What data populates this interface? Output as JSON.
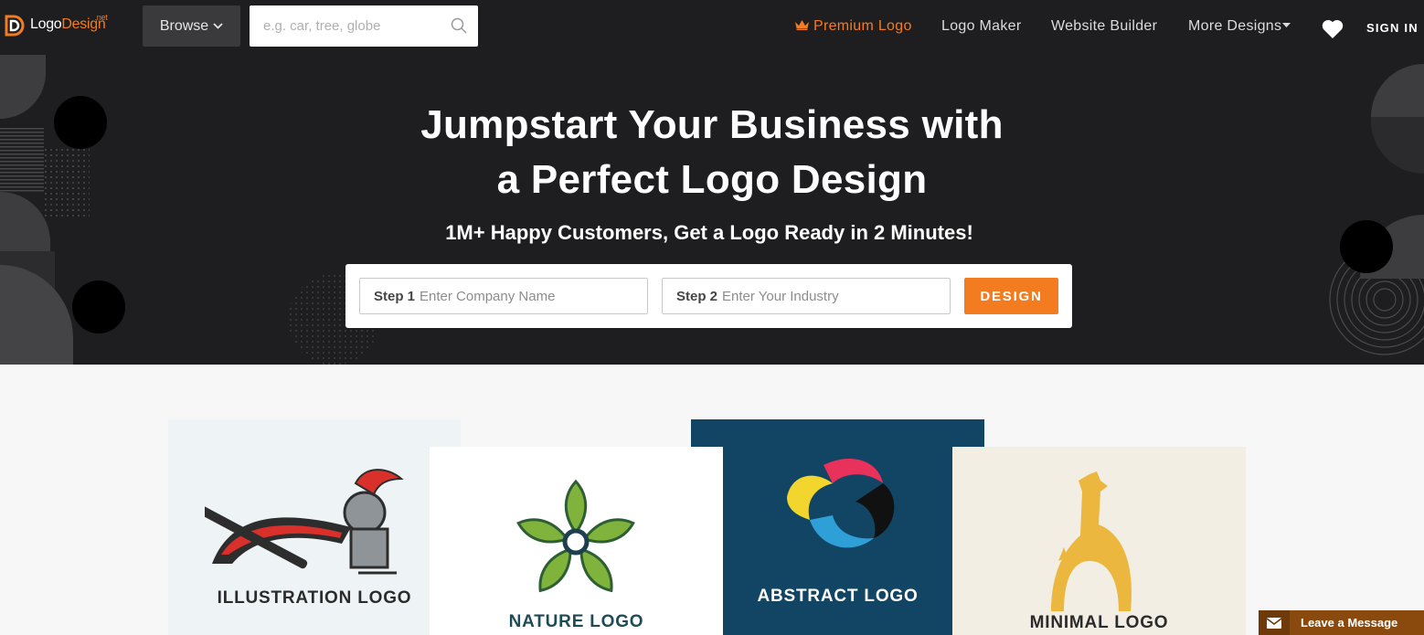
{
  "header": {
    "logo": {
      "text_main": "Logo",
      "text_accent": "Design",
      "superscript": ".net"
    },
    "browse_label": "Browse",
    "search": {
      "placeholder": "e.g. car, tree, globe"
    },
    "nav": [
      {
        "label": "Premium Logo",
        "icon": "crown-icon",
        "color": "#f47c20"
      },
      {
        "label": "Logo Maker"
      },
      {
        "label": "Website Builder"
      },
      {
        "label": "More Designs"
      }
    ],
    "favorites_icon": "heart-icon",
    "signin_label": "SIGN IN"
  },
  "hero": {
    "title_line1": "Jumpstart Your Business with",
    "title_line2": "a Perfect Logo Design",
    "subtitle": "1M+ Happy Customers, Get a Logo Ready in 2 Minutes!",
    "form": {
      "step1_label": "Step 1",
      "step1_placeholder": "Enter Company Name",
      "step2_label": "Step 2",
      "step2_placeholder": "Enter Your Industry",
      "button_label": "DESIGN"
    }
  },
  "categories": [
    {
      "label": "ILLUSTRATION LOGO"
    },
    {
      "label": "NATURE LOGO"
    },
    {
      "label": "ABSTRACT LOGO"
    },
    {
      "label": "MINIMAL LOGO"
    }
  ],
  "chat_widget": {
    "label": "Leave a Message",
    "icon": "envelope-icon"
  },
  "colors": {
    "accent": "#f47c20",
    "header_bg": "#1e1d1f",
    "abstract_bg": "#124563",
    "minimal_bg": "#f2eee4"
  }
}
